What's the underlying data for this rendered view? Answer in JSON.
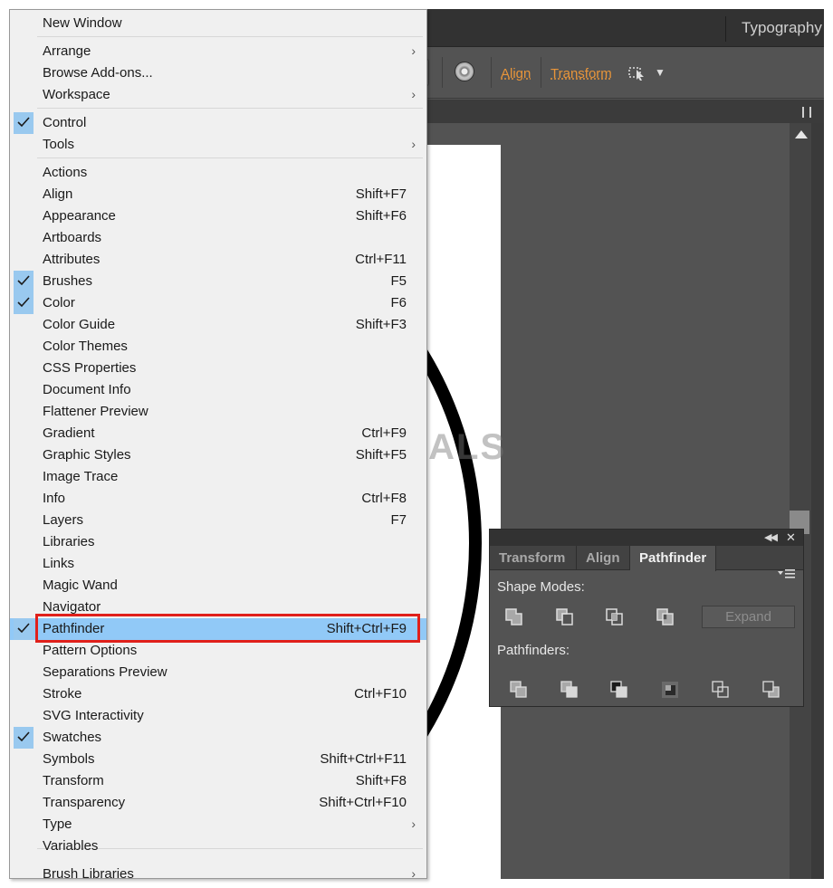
{
  "app": {
    "workspace_name": "Typography",
    "control_bar": {
      "align_link": "Align",
      "transform_link": "Transform"
    }
  },
  "watermark": "APPUALS",
  "menu": {
    "items": [
      {
        "label": "New Window",
        "shortcut": "",
        "checked": false,
        "submenu": false
      },
      {
        "label": "Arrange",
        "shortcut": "",
        "checked": false,
        "submenu": true
      },
      {
        "label": "Browse Add-ons...",
        "shortcut": "",
        "checked": false,
        "submenu": false
      },
      {
        "label": "Workspace",
        "shortcut": "",
        "checked": false,
        "submenu": true
      },
      {
        "label": "Control",
        "shortcut": "",
        "checked": true,
        "submenu": false
      },
      {
        "label": "Tools",
        "shortcut": "",
        "checked": false,
        "submenu": true
      },
      {
        "label": "Actions",
        "shortcut": "",
        "checked": false,
        "submenu": false
      },
      {
        "label": "Align",
        "shortcut": "Shift+F7",
        "checked": false,
        "submenu": false
      },
      {
        "label": "Appearance",
        "shortcut": "Shift+F6",
        "checked": false,
        "submenu": false
      },
      {
        "label": "Artboards",
        "shortcut": "",
        "checked": false,
        "submenu": false
      },
      {
        "label": "Attributes",
        "shortcut": "Ctrl+F11",
        "checked": false,
        "submenu": false
      },
      {
        "label": "Brushes",
        "shortcut": "F5",
        "checked": true,
        "submenu": false
      },
      {
        "label": "Color",
        "shortcut": "F6",
        "checked": true,
        "submenu": false
      },
      {
        "label": "Color Guide",
        "shortcut": "Shift+F3",
        "checked": false,
        "submenu": false
      },
      {
        "label": "Color Themes",
        "shortcut": "",
        "checked": false,
        "submenu": false
      },
      {
        "label": "CSS Properties",
        "shortcut": "",
        "checked": false,
        "submenu": false
      },
      {
        "label": "Document Info",
        "shortcut": "",
        "checked": false,
        "submenu": false
      },
      {
        "label": "Flattener Preview",
        "shortcut": "",
        "checked": false,
        "submenu": false
      },
      {
        "label": "Gradient",
        "shortcut": "Ctrl+F9",
        "checked": false,
        "submenu": false
      },
      {
        "label": "Graphic Styles",
        "shortcut": "Shift+F5",
        "checked": false,
        "submenu": false
      },
      {
        "label": "Image Trace",
        "shortcut": "",
        "checked": false,
        "submenu": false
      },
      {
        "label": "Info",
        "shortcut": "Ctrl+F8",
        "checked": false,
        "submenu": false
      },
      {
        "label": "Layers",
        "shortcut": "F7",
        "checked": false,
        "submenu": false
      },
      {
        "label": "Libraries",
        "shortcut": "",
        "checked": false,
        "submenu": false
      },
      {
        "label": "Links",
        "shortcut": "",
        "checked": false,
        "submenu": false
      },
      {
        "label": "Magic Wand",
        "shortcut": "",
        "checked": false,
        "submenu": false
      },
      {
        "label": "Navigator",
        "shortcut": "",
        "checked": false,
        "submenu": false
      },
      {
        "label": "Pathfinder",
        "shortcut": "Shift+Ctrl+F9",
        "checked": true,
        "submenu": false,
        "selected": true
      },
      {
        "label": "Pattern Options",
        "shortcut": "",
        "checked": false,
        "submenu": false
      },
      {
        "label": "Separations Preview",
        "shortcut": "",
        "checked": false,
        "submenu": false
      },
      {
        "label": "Stroke",
        "shortcut": "Ctrl+F10",
        "checked": false,
        "submenu": false
      },
      {
        "label": "SVG Interactivity",
        "shortcut": "",
        "checked": false,
        "submenu": false
      },
      {
        "label": "Swatches",
        "shortcut": "",
        "checked": true,
        "submenu": false
      },
      {
        "label": "Symbols",
        "shortcut": "Shift+Ctrl+F11",
        "checked": false,
        "submenu": false
      },
      {
        "label": "Transform",
        "shortcut": "Shift+F8",
        "checked": false,
        "submenu": false
      },
      {
        "label": "Transparency",
        "shortcut": "Shift+Ctrl+F10",
        "checked": false,
        "submenu": false
      },
      {
        "label": "Type",
        "shortcut": "",
        "checked": false,
        "submenu": true
      },
      {
        "label": "Variables",
        "shortcut": "",
        "checked": false,
        "submenu": false
      },
      {
        "label": "Brush Libraries",
        "shortcut": "",
        "checked": false,
        "submenu": true
      }
    ]
  },
  "panel": {
    "tabs": [
      "Transform",
      "Align",
      "Pathfinder"
    ],
    "active_tab": "Pathfinder",
    "shape_modes_label": "Shape Modes:",
    "pathfinders_label": "Pathfinders:",
    "expand_label": "Expand",
    "shape_mode_buttons": [
      "unite-icon",
      "minus-front-icon",
      "intersect-icon",
      "exclude-icon"
    ],
    "pathfinder_buttons": [
      "divide-icon",
      "trim-icon",
      "merge-icon",
      "crop-icon",
      "outline-icon",
      "minus-back-icon"
    ]
  },
  "colors": {
    "highlight_border": "#e0201b",
    "selection": "#91c9f7",
    "check_background": "#99c9ef",
    "link_orange": "#e8953a"
  }
}
